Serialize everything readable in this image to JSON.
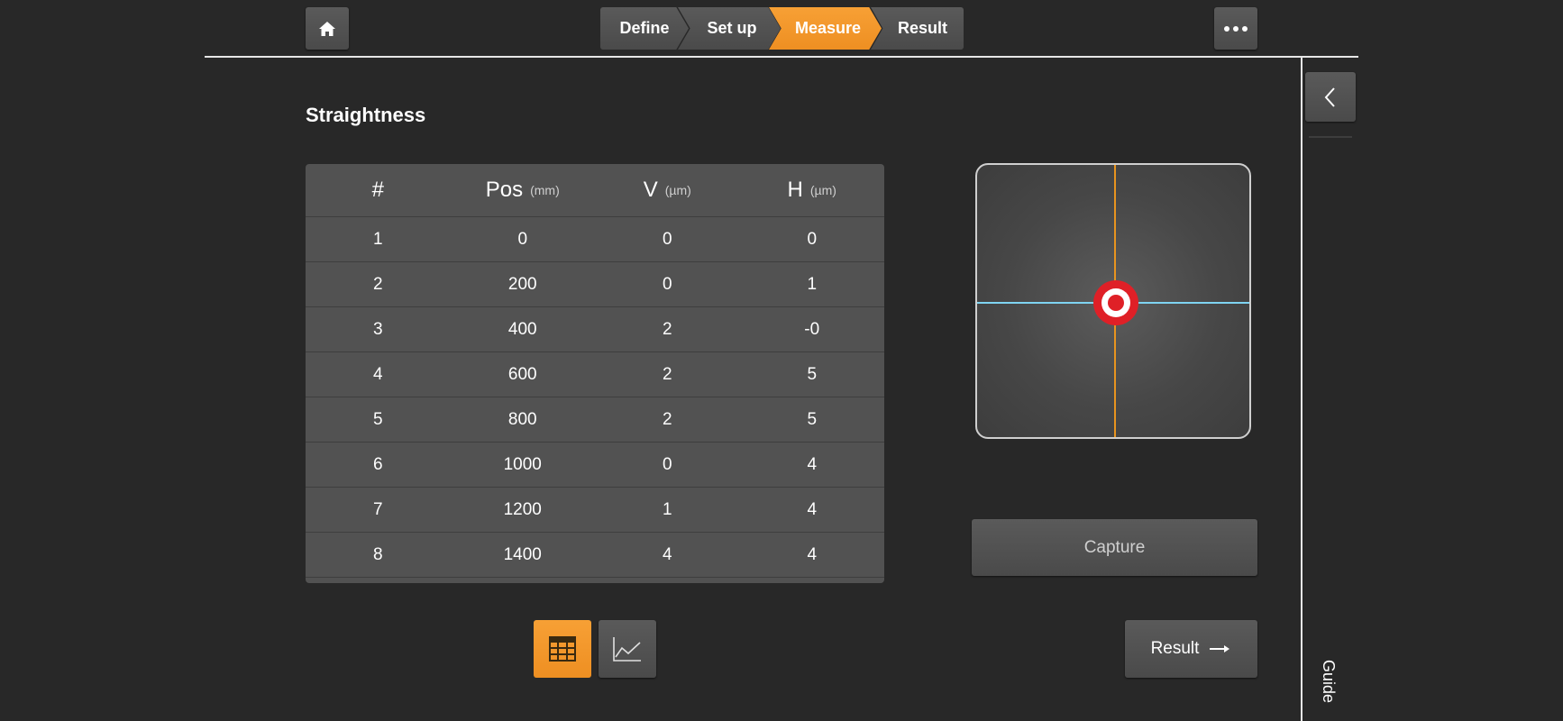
{
  "header": {
    "steps": [
      {
        "label": "Define",
        "active": false
      },
      {
        "label": "Set up",
        "active": false
      },
      {
        "label": "Measure",
        "active": true
      },
      {
        "label": "Result",
        "active": false
      }
    ],
    "home_icon": "home-icon",
    "more_icon": "more-horizontal-icon"
  },
  "page": {
    "title": "Straightness"
  },
  "table": {
    "headers": [
      {
        "label": "#",
        "unit": ""
      },
      {
        "label": "Pos",
        "unit": "(mm)"
      },
      {
        "label": "V",
        "unit": "(µm)"
      },
      {
        "label": "H",
        "unit": "(µm)"
      }
    ],
    "rows": [
      [
        "1",
        "0",
        "0",
        "0"
      ],
      [
        "2",
        "200",
        "0",
        "1"
      ],
      [
        "3",
        "400",
        "2",
        "-0"
      ],
      [
        "4",
        "600",
        "2",
        "5"
      ],
      [
        "5",
        "800",
        "2",
        "5"
      ],
      [
        "6",
        "1000",
        "0",
        "4"
      ],
      [
        "7",
        "1200",
        "1",
        "4"
      ],
      [
        "8",
        "1400",
        "4",
        "4"
      ]
    ]
  },
  "actions": {
    "capture_label": "Capture",
    "result_label": "Result"
  },
  "sidebar": {
    "guide_label": "Guide"
  },
  "colors": {
    "accent": "#F39A2B",
    "target_red": "#DF2027",
    "horizontal_line": "#7FD4F2",
    "vertical_line": "#E8941F",
    "background": "#282828"
  }
}
